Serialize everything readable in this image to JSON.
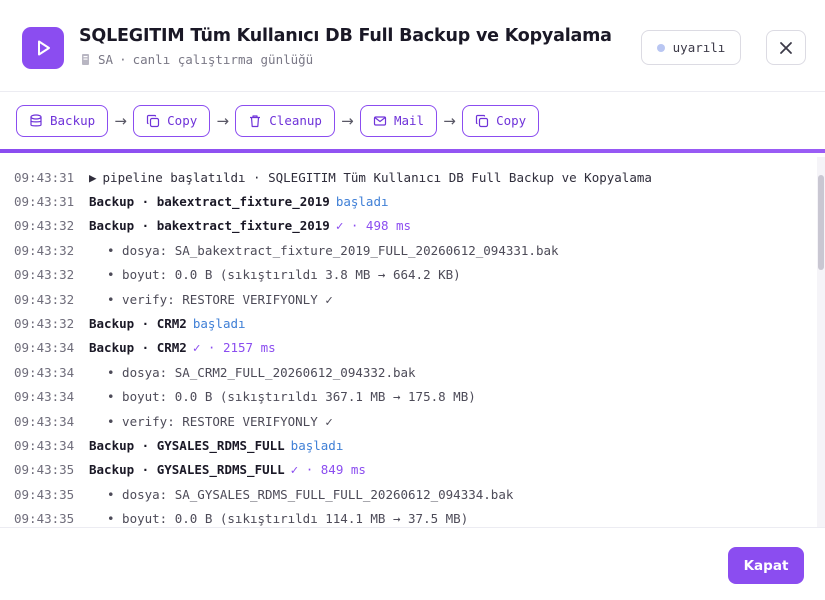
{
  "header": {
    "title": "SQLEGITIM Tüm Kullanıcı DB Full Backup ve Kopyalama",
    "subtitle_user": "SA",
    "subtitle_sep": "·",
    "subtitle_text": "canlı çalıştırma günlüğü",
    "status_label": "uyarılı",
    "accent_color": "#8b4df0"
  },
  "pipeline": {
    "steps": [
      {
        "label": "Backup",
        "icon": "database-icon"
      },
      {
        "label": "Copy",
        "icon": "copy-icon"
      },
      {
        "label": "Cleanup",
        "icon": "trash-icon"
      },
      {
        "label": "Mail",
        "icon": "mail-icon"
      },
      {
        "label": "Copy",
        "icon": "copy-icon"
      }
    ],
    "arrow": "→"
  },
  "log": [
    {
      "time": "09:43:31",
      "kind": "start",
      "text": "pipeline başlatıldı · SQLEGITIM Tüm Kullanıcı DB Full Backup ve Kopyalama"
    },
    {
      "time": "09:43:31",
      "kind": "begin",
      "text": "Backup · bakextract_fixture_2019",
      "tag": "başladı"
    },
    {
      "time": "09:43:32",
      "kind": "done",
      "text": "Backup · bakextract_fixture_2019",
      "tag": "✓ · 498 ms"
    },
    {
      "time": "09:43:32",
      "kind": "detail",
      "text": "• dosya: SA_bakextract_fixture_2019_FULL_20260612_094331.bak"
    },
    {
      "time": "09:43:32",
      "kind": "detail",
      "text": "• boyut: 0.0 B (sıkıştırıldı 3.8 MB → 664.2 KB)"
    },
    {
      "time": "09:43:32",
      "kind": "detail",
      "text": "• verify: RESTORE VERIFYONLY ✓"
    },
    {
      "time": "09:43:32",
      "kind": "begin",
      "text": "Backup · CRM2",
      "tag": "başladı"
    },
    {
      "time": "09:43:34",
      "kind": "done",
      "text": "Backup · CRM2",
      "tag": "✓ · 2157 ms"
    },
    {
      "time": "09:43:34",
      "kind": "detail",
      "text": "• dosya: SA_CRM2_FULL_20260612_094332.bak"
    },
    {
      "time": "09:43:34",
      "kind": "detail",
      "text": "• boyut: 0.0 B (sıkıştırıldı 367.1 MB → 175.8 MB)"
    },
    {
      "time": "09:43:34",
      "kind": "detail",
      "text": "• verify: RESTORE VERIFYONLY ✓"
    },
    {
      "time": "09:43:34",
      "kind": "begin",
      "text": "Backup · GYSALES_RDMS_FULL",
      "tag": "başladı"
    },
    {
      "time": "09:43:35",
      "kind": "done",
      "text": "Backup · GYSALES_RDMS_FULL",
      "tag": "✓ · 849 ms"
    },
    {
      "time": "09:43:35",
      "kind": "detail",
      "text": "• dosya: SA_GYSALES_RDMS_FULL_FULL_20260612_094334.bak"
    },
    {
      "time": "09:43:35",
      "kind": "detail",
      "text": "• boyut: 0.0 B (sıkıştırıldı 114.1 MB → 37.5 MB)"
    }
  ],
  "footer": {
    "close_label": "Kapat"
  }
}
